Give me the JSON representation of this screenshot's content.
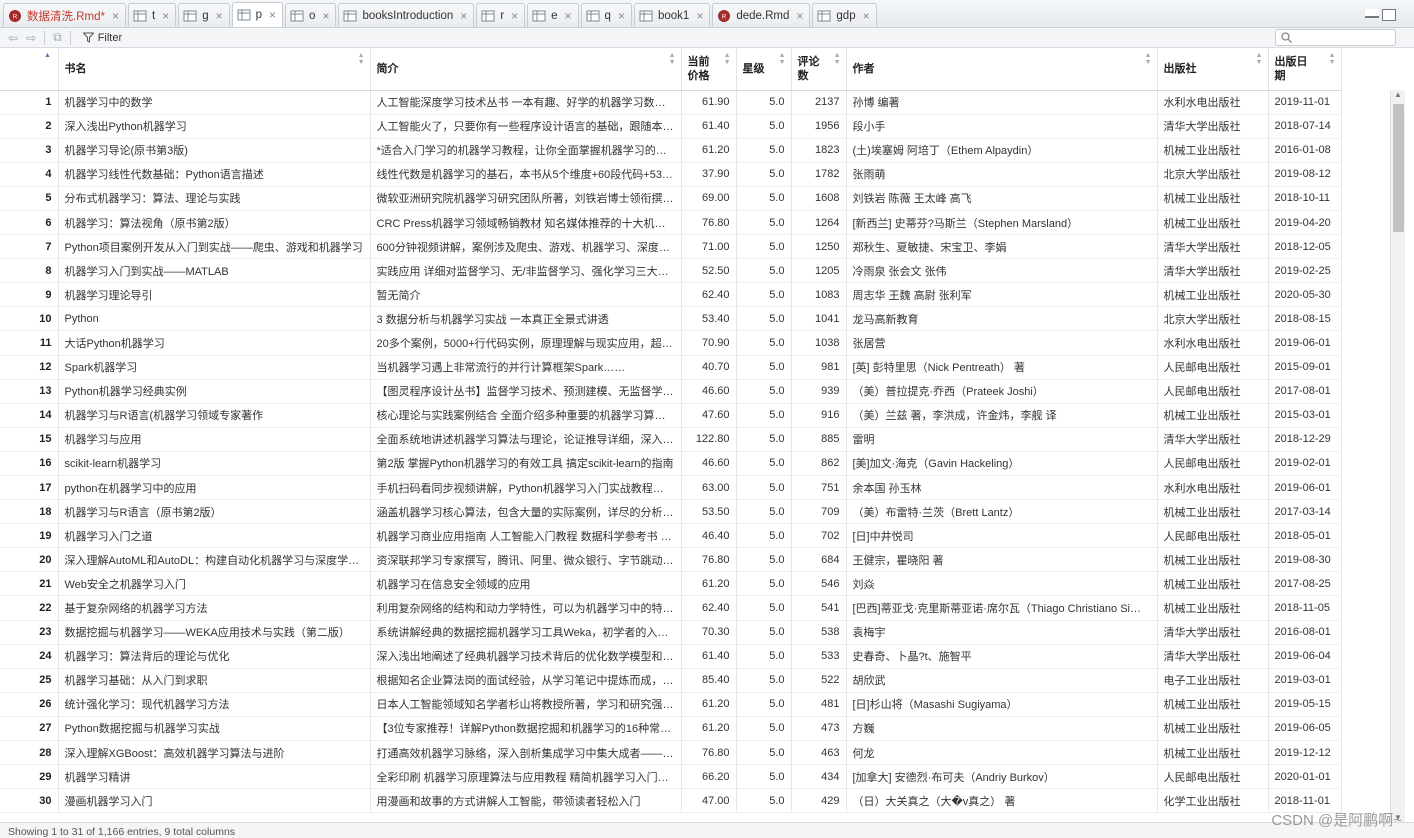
{
  "tabs": [
    {
      "label": "数据清洗.Rmd*",
      "icon": "rmd-icon",
      "active": false,
      "modified": true
    },
    {
      "label": "t",
      "icon": "table-icon",
      "active": false
    },
    {
      "label": "g",
      "icon": "table-icon",
      "active": false
    },
    {
      "label": "p",
      "icon": "table-icon",
      "active": true
    },
    {
      "label": "o",
      "icon": "table-icon",
      "active": false
    },
    {
      "label": "booksIntroduction",
      "icon": "table-icon",
      "active": false
    },
    {
      "label": "r",
      "icon": "table-icon",
      "active": false
    },
    {
      "label": "e",
      "icon": "table-icon",
      "active": false
    },
    {
      "label": "q",
      "icon": "table-icon",
      "active": false
    },
    {
      "label": "book1",
      "icon": "table-icon",
      "active": false
    },
    {
      "label": "dede.Rmd",
      "icon": "rmd-icon",
      "active": false
    },
    {
      "label": "gdp",
      "icon": "table-icon",
      "active": false
    }
  ],
  "toolbar": {
    "filter_label": "Filter",
    "search_placeholder": ""
  },
  "columns": [
    "书名",
    "简介",
    "当前价格",
    "星级",
    "评论数",
    "作者",
    "出版社",
    "出版日期"
  ],
  "column_display": [
    "书名",
    "简介",
    "当前\n价格",
    "星级",
    "评论\n数",
    "作者",
    "出版社",
    "出版日\n期"
  ],
  "rows": [
    [
      "1",
      "机器学习中的数学",
      "人工智能深度学习技术丛书 一本有趣、好学的机器学习数学…",
      "61.90",
      "5.0",
      "2137",
      "孙博 编著",
      "水利水电出版社",
      "2019-11-01"
    ],
    [
      "2",
      "深入浅出Python机器学习",
      "人工智能火了，只要你有一些程序设计语言的基础，跟随本…",
      "61.40",
      "5.0",
      "1956",
      "段小手",
      "清华大学出版社",
      "2018-07-14"
    ],
    [
      "3",
      "机器学习导论(原书第3版)",
      "*适合入门学习的机器学习教程，让你全面掌握机器学习的方…",
      "61.20",
      "5.0",
      "1823",
      "(土)埃塞姆 阿培丁（Ethem Alpaydin）",
      "机械工业出版社",
      "2016-01-08"
    ],
    [
      "4",
      "机器学习线性代数基础：Python语言描述",
      "线性代数是机器学习的基石，本书从5个维度+60段代码+53…",
      "37.90",
      "5.0",
      "1782",
      "张雨萌",
      "北京大学出版社",
      "2019-08-12"
    ],
    [
      "5",
      "分布式机器学习：算法、理论与实践",
      "微软亚洲研究院机器学习研究团队所著，刘铁岩博士领衔撰…",
      "69.00",
      "5.0",
      "1608",
      "刘铁岩 陈薇 王太峰 高飞",
      "机械工业出版社",
      "2018-10-11"
    ],
    [
      "6",
      "机器学习：算法视角（原书第2版）",
      "CRC Press机器学习领域畅销教材 知名媒体推荐的十大机器…",
      "76.80",
      "5.0",
      "1264",
      "[新西兰] 史蒂芬?马斯兰（Stephen Marsland）",
      "机械工业出版社",
      "2019-04-20"
    ],
    [
      "7",
      "Python项目案例开发从入门到实战——爬虫、游戏和机器学习",
      "600分钟视频讲解，案例涉及爬虫、游戏、机器学习、深度…",
      "71.00",
      "5.0",
      "1250",
      "郑秋生、夏敏捷、宋宝卫、李娟",
      "清华大学出版社",
      "2018-12-05"
    ],
    [
      "8",
      "机器学习入门到实战——MATLAB",
      "实践应用 详细对监督学习、无/非监督学习、强化学习三大…",
      "52.50",
      "5.0",
      "1205",
      "冷雨泉 张会文 张伟",
      "清华大学出版社",
      "2019-02-25"
    ],
    [
      "9",
      "机器学习理论导引",
      "暂无简介",
      "62.40",
      "5.0",
      "1083",
      "周志华 王魏 高尉 张利军",
      "机械工业出版社",
      "2020-05-30"
    ],
    [
      "10",
      "Python",
      "3 数据分析与机器学习实战 一本真正全景式讲透",
      "53.40",
      "5.0",
      "1041",
      "龙马高新教育",
      "北京大学出版社",
      "2018-08-15"
    ],
    [
      "11",
      "大话Python机器学习",
      "20多个案例，5000+行代码实例，原理理解与现实应用，超…",
      "70.90",
      "5.0",
      "1038",
      "张居营",
      "水利水电出版社",
      "2019-06-01"
    ],
    [
      "12",
      "Spark机器学习",
      "当机器学习遇上非常流行的并行计算框架Spark……",
      "40.70",
      "5.0",
      "981",
      "[英] 彭特里思（Nick Pentreath） 著",
      "人民邮电出版社",
      "2015-09-01"
    ],
    [
      "13",
      "Python机器学习经典实例",
      "【图灵程序设计丛书】监督学习技术、预测建模、无监督学…",
      "46.60",
      "5.0",
      "939",
      "（美）普拉提克·乔西（Prateek Joshi）",
      "人民邮电出版社",
      "2017-08-01"
    ],
    [
      "14",
      "机器学习与R语言(机器学习领域专家著作",
      "核心理论与实践案例结合 全面介绍多种重要的机器学习算法…",
      "47.60",
      "5.0",
      "916",
      "（美）兰兹 著，李洪成，许金炜，李舰 译",
      "机械工业出版社",
      "2015-03-01"
    ],
    [
      "15",
      "机器学习与应用",
      "全面系统地讲述机器学习算法与理论，论证推导详细，深入…",
      "122.80",
      "5.0",
      "885",
      "雷明",
      "清华大学出版社",
      "2018-12-29"
    ],
    [
      "16",
      "scikit-learn机器学习",
      "第2版 掌握Python机器学习的有效工具 搞定scikit-learn的指南",
      "46.60",
      "5.0",
      "862",
      "[美]加文·海克（Gavin Hackeling）",
      "人民邮电出版社",
      "2019-02-01"
    ],
    [
      "17",
      "python在机器学习中的应用",
      "手机扫码看同步视频讲解，Python机器学习入门实战教程，…",
      "63.00",
      "5.0",
      "751",
      "余本国 孙玉林",
      "水利水电出版社",
      "2019-06-01"
    ],
    [
      "18",
      "机器学习与R语言（原书第2版）",
      "涵盖机器学习核心算法，包含大量的实际案例，详尽的分析…",
      "53.50",
      "5.0",
      "709",
      "（美）布雷特·兰茨（Brett Lantz）",
      "机械工业出版社",
      "2017-03-14"
    ],
    [
      "19",
      "机器学习入门之道",
      "机器学习商业应用指南 人工智能入门教程 数据科学参考书 …",
      "46.40",
      "5.0",
      "702",
      "[日]中井悦司",
      "人民邮电出版社",
      "2018-05-01"
    ],
    [
      "20",
      "深入理解AutoML和AutoDL：构建自动化机器学习与深度学…",
      "资深联邦学习专家撰写，腾讯、阿里、微众银行、字节跳动…",
      "76.80",
      "5.0",
      "684",
      "王健宗，瞿晓阳 著",
      "机械工业出版社",
      "2019-08-30"
    ],
    [
      "21",
      "Web安全之机器学习入门",
      "机器学习在信息安全领域的应用",
      "61.20",
      "5.0",
      "546",
      "刘焱",
      "机械工业出版社",
      "2017-08-25"
    ],
    [
      "22",
      "基于复杂网络的机器学习方法",
      "利用复杂网络的结构和动力学特性，可以为机器学习中的特…",
      "62.40",
      "5.0",
      "541",
      "[巴西]蒂亚戈·克里斯蒂亚诺·席尔瓦（Thiago Christiano Si…",
      "机械工业出版社",
      "2018-11-05"
    ],
    [
      "23",
      "数据挖掘与机器学习——WEKA应用技术与实践（第二版）",
      "系统讲解经典的数据挖掘机器学习工具Weka，初学者的入门…",
      "70.30",
      "5.0",
      "538",
      "袁梅宇",
      "清华大学出版社",
      "2016-08-01"
    ],
    [
      "24",
      "机器学习：算法背后的理论与优化",
      "深入浅出地阐述了经典机器学习技术背后的优化数学模型和…",
      "61.40",
      "5.0",
      "533",
      "史春奇、卜晶?t、施智平",
      "清华大学出版社",
      "2019-06-04"
    ],
    [
      "25",
      "机器学习基础：从入门到求职",
      "根据知名企业算法岗的面试经验，从学习笔记中提炼而成，…",
      "85.40",
      "5.0",
      "522",
      "胡欣武",
      "电子工业出版社",
      "2019-03-01"
    ],
    [
      "26",
      "统计强化学习：现代机器学习方法",
      "日本人工智能领域知名学者杉山将教授所著，学习和研究强…",
      "61.20",
      "5.0",
      "481",
      "[日]杉山将（Masashi Sugiyama）",
      "机械工业出版社",
      "2019-05-15"
    ],
    [
      "27",
      "Python数据挖掘与机器学习实战",
      "【3位专家推荐！详解Python数据挖掘和机器学习的16种常…",
      "61.20",
      "5.0",
      "473",
      "方巍",
      "机械工业出版社",
      "2019-06-05"
    ],
    [
      "28",
      "深入理解XGBoost：高效机器学习算法与进阶",
      "打通高效机器学习脉络，深入剖析集成学习中集大成者——…",
      "76.80",
      "5.0",
      "463",
      "何龙",
      "机械工业出版社",
      "2019-12-12"
    ],
    [
      "29",
      "机器学习精讲",
      "全彩印刷 机器学习原理算法与应用教程 精简机器学习入门…",
      "66.20",
      "5.0",
      "434",
      "[加拿大] 安德烈·布可夫（Andriy Burkov）",
      "人民邮电出版社",
      "2020-01-01"
    ],
    [
      "30",
      "漫画机器学习入门",
      "用漫画和故事的方式讲解人工智能，带领读者轻松入门",
      "47.00",
      "5.0",
      "429",
      "（日）大关真之（大�v真之） 著",
      "化学工业出版社",
      "2018-11-01"
    ]
  ],
  "status_text": "Showing 1 to 31 of 1,166 entries, 9 total columns",
  "watermark": "CSDN @是阿鹏啊~",
  "colors": {
    "modified_tab": "#c0392b",
    "sort_active": "#3b7dc9"
  }
}
